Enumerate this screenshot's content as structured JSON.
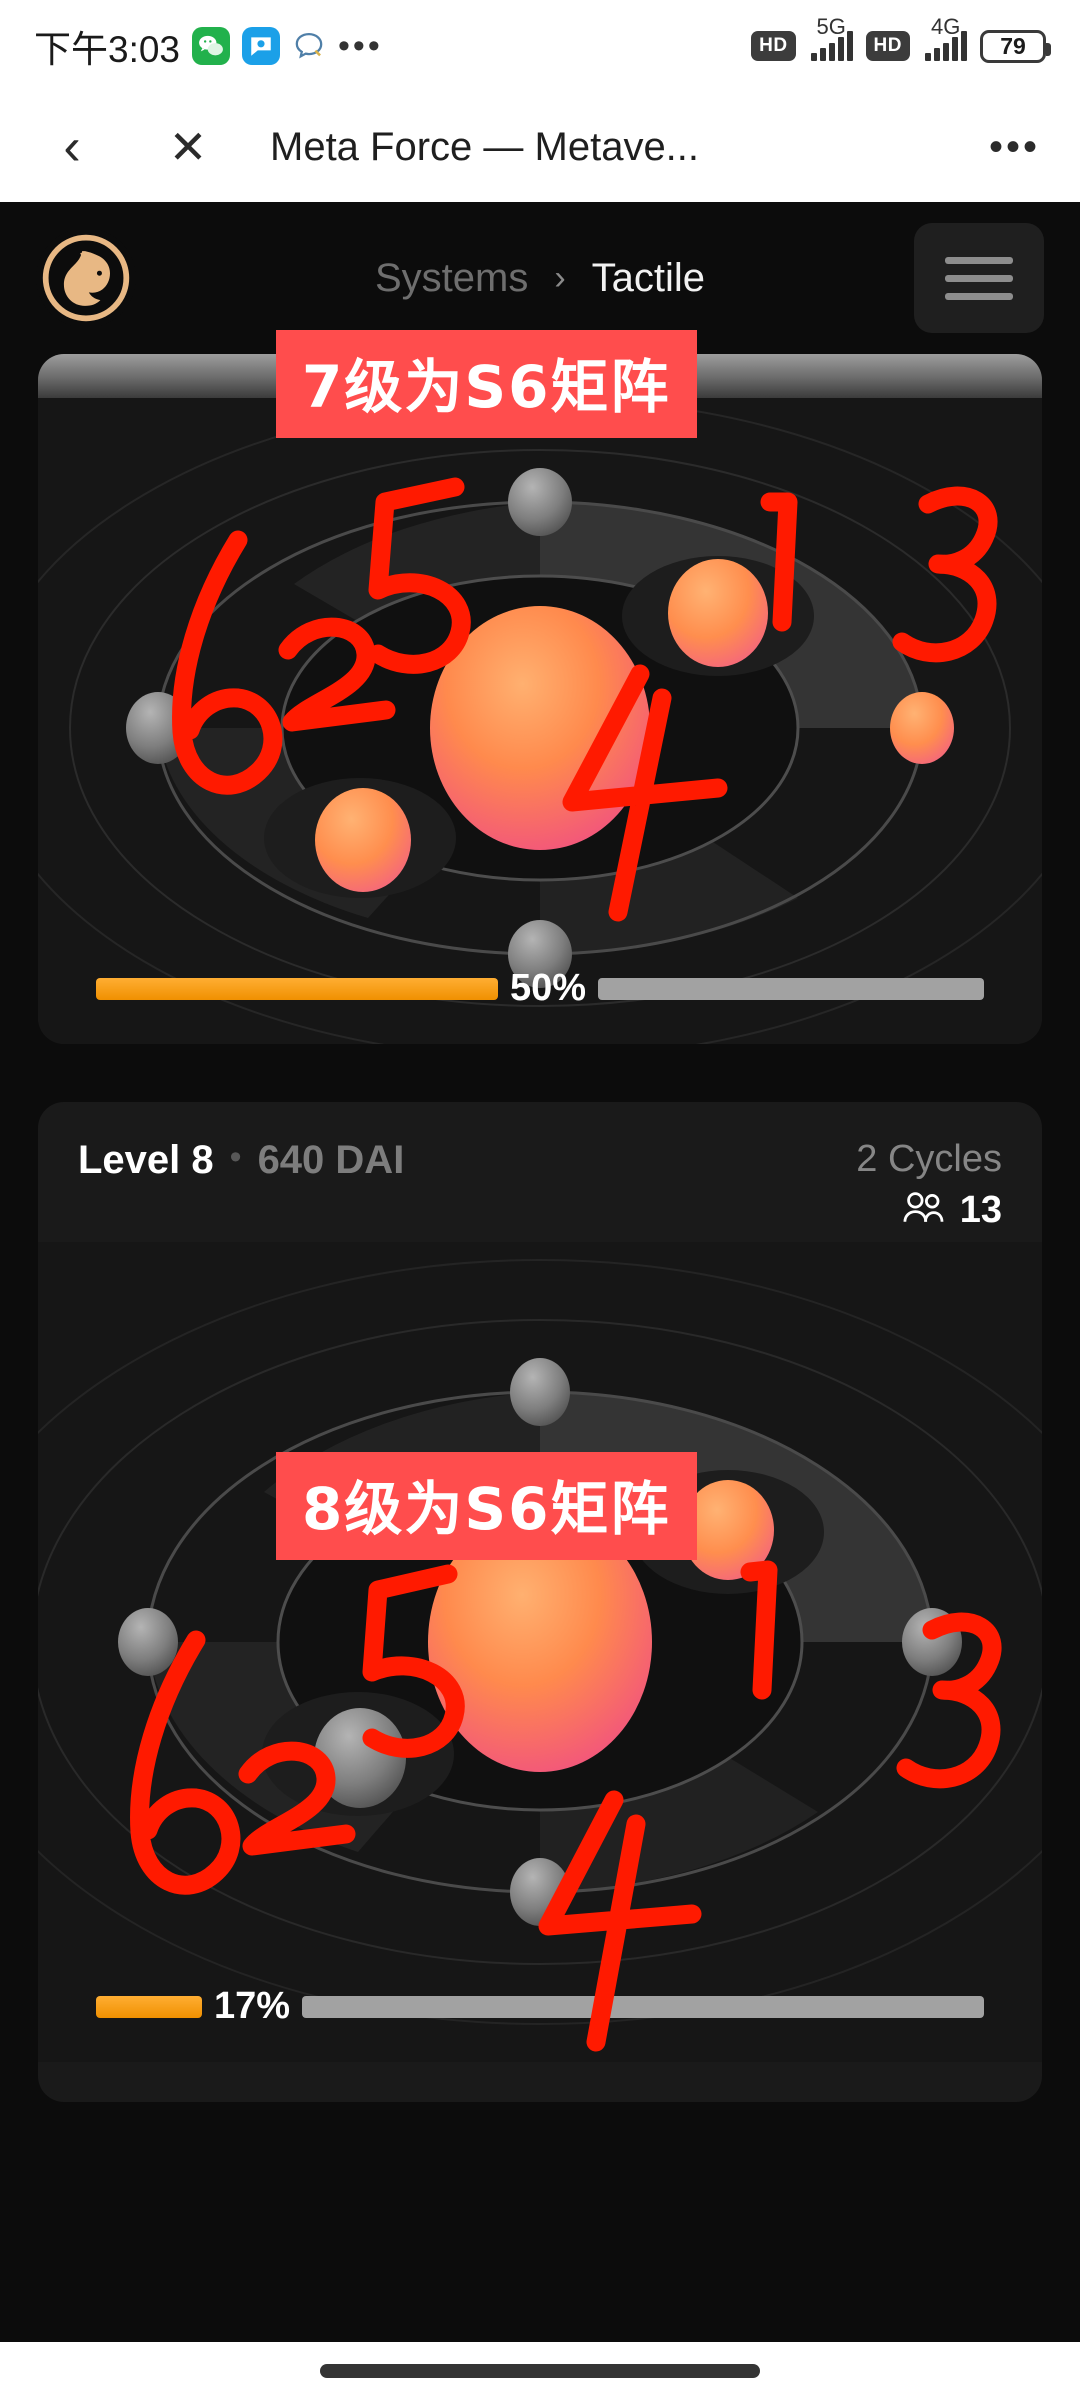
{
  "status_bar": {
    "time": "下午3:03",
    "app_icons": [
      "wechat-icon",
      "blue-app-icon",
      "chat-bubble-icon",
      "overflow-dots-icon"
    ],
    "sim1_hd": "HD",
    "sim1_network": "5G",
    "sim2_hd": "HD",
    "sim2_network": "4G",
    "battery_percent": "79"
  },
  "nav_bar": {
    "back_icon": "chevron-left-icon",
    "close_icon": "close-x-icon",
    "title": "Meta Force — Metave...",
    "more_icon": "overflow-dots-icon"
  },
  "app_header": {
    "logo_icon": "horse-head-logo",
    "breadcrumb": {
      "parent": "Systems",
      "separator": "›",
      "current": "Tactile"
    },
    "menu_icon": "hamburger-menu-icon"
  },
  "colors": {
    "accent_orange": "#f09000",
    "annotation_red": "#ff4d4d",
    "card_bg": "#1a1a1a",
    "page_bg": "#0c0c0c",
    "planet_filled_from": "#ff9e52",
    "planet_filled_to": "#f4607a",
    "planet_empty": "#8d8d8d",
    "progress_track": "#a2a2a2"
  },
  "cards": [
    {
      "id": "level-7-card",
      "level_label": "",
      "price_label": "",
      "cycles_label": "",
      "members_icon": "people-icon",
      "members_count": "",
      "progress_percent": "50%",
      "progress_value": 50,
      "annotation": "7级为S6矩阵",
      "slots": [
        {
          "number": "1",
          "state": "filled"
        },
        {
          "number": "2",
          "state": "filled"
        },
        {
          "number": "3",
          "state": "filled"
        },
        {
          "number": "4",
          "state": "empty"
        },
        {
          "number": "5",
          "state": "empty"
        },
        {
          "number": "6",
          "state": "empty"
        }
      ]
    },
    {
      "id": "level-8-card",
      "level_label": "Level 8",
      "price_label": "640 DAI",
      "separator_dot": "•",
      "cycles_label": "2 Cycles",
      "members_icon": "people-icon",
      "members_count": "13",
      "progress_percent": "17%",
      "progress_value": 17,
      "annotation": "8级为S6矩阵",
      "slots": [
        {
          "number": "1",
          "state": "filled"
        },
        {
          "number": "2",
          "state": "empty"
        },
        {
          "number": "3",
          "state": "empty"
        },
        {
          "number": "4",
          "state": "empty"
        },
        {
          "number": "5",
          "state": "empty"
        },
        {
          "number": "6",
          "state": "empty"
        }
      ]
    }
  ],
  "handwritten_numbers": [
    "1",
    "2",
    "3",
    "4",
    "5",
    "6"
  ],
  "home_indicator": "home-gesture-bar"
}
